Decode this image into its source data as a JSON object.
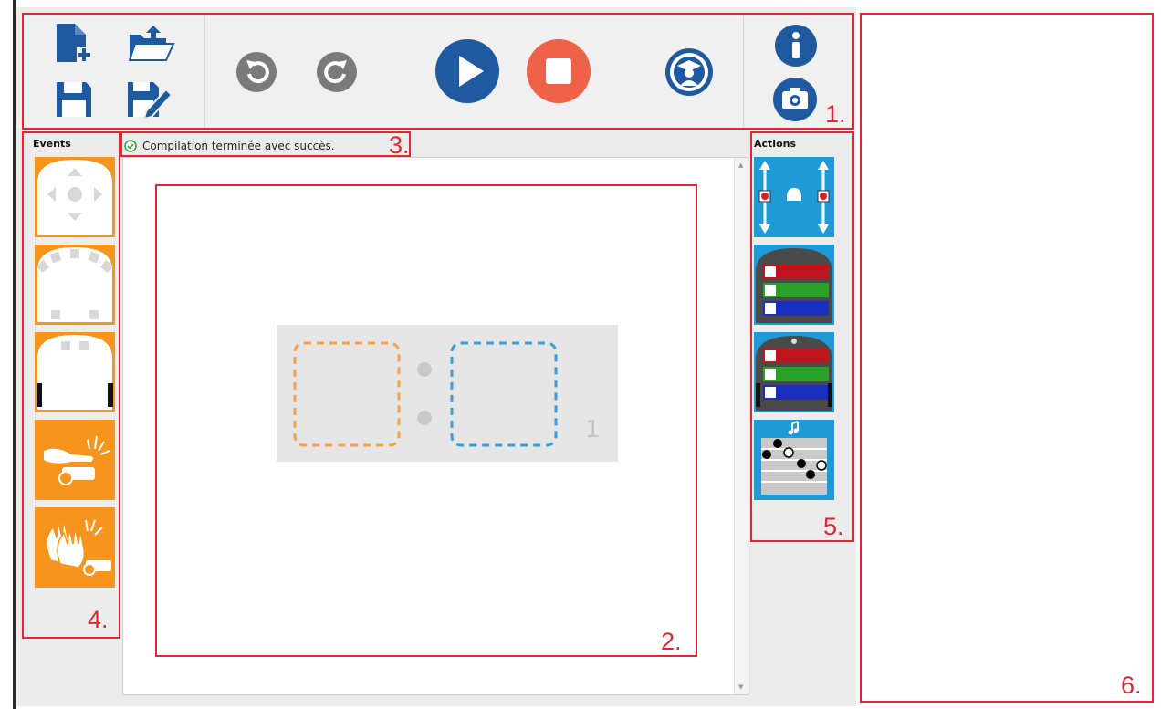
{
  "toolbar": {
    "buttons": [
      {
        "name": "new-file-icon"
      },
      {
        "name": "open-folder-icon"
      },
      {
        "name": "save-icon"
      },
      {
        "name": "save-as-icon"
      },
      {
        "name": "undo-icon"
      },
      {
        "name": "redo-icon"
      },
      {
        "name": "play-icon"
      },
      {
        "name": "stop-icon"
      },
      {
        "name": "teacher-mode-icon"
      },
      {
        "name": "info-icon"
      },
      {
        "name": "screenshot-icon"
      }
    ]
  },
  "status": {
    "message": "Compilation terminée avec succès."
  },
  "events_panel": {
    "title": "Events",
    "blocks": [
      "buttons-event",
      "prox-horizontal-event",
      "prox-ground-event",
      "tap-event",
      "clap-event"
    ]
  },
  "actions_panel": {
    "title": "Actions",
    "blocks": [
      "motors-action",
      "top-color-action",
      "bottom-color-action",
      "music-action"
    ]
  },
  "workspace": {
    "rule_number": "1"
  },
  "annotations": {
    "toolbar": "1.",
    "workspace": "2.",
    "status": "3.",
    "events": "4.",
    "actions": "5.",
    "side_panel": "6."
  },
  "colors": {
    "annotation_red": "#e3262f",
    "primary_blue": "#1f5aa0",
    "stop_orange": "#ef6148",
    "event_orange": "#f7941d",
    "action_blue": "#1e9ad6"
  }
}
